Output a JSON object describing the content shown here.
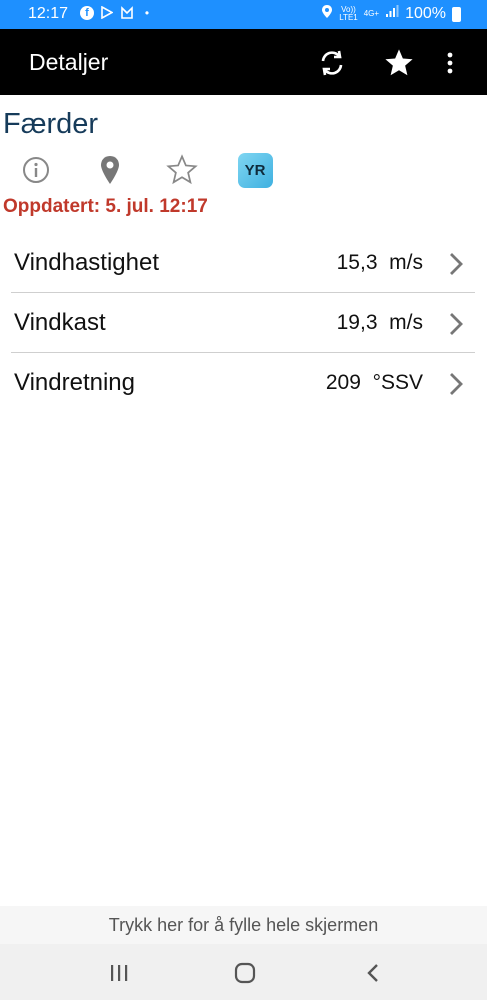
{
  "status_bar": {
    "time": "12:17",
    "network": "4G+",
    "lte": "LTE1",
    "volte": "Vo))",
    "battery": "100%",
    "left_icons": [
      "facebook-icon",
      "play-store-icon",
      "mail-icon",
      "dot-icon"
    ],
    "right_icons": [
      "location-icon",
      "volte-icon",
      "signal-icon",
      "battery-icon"
    ]
  },
  "app_bar": {
    "title": "Detaljer",
    "actions": [
      "refresh-icon",
      "star-icon",
      "more-icon"
    ]
  },
  "station": {
    "name": "Færder",
    "icons": [
      "info-icon",
      "location-pin-icon",
      "favorite-star-icon",
      "yr-logo"
    ],
    "yr_label": "YR",
    "updated": "Oppdatert: 5. jul. 12:17"
  },
  "measurements": [
    {
      "label": "Vindhastighet",
      "value": "15,3  m/s"
    },
    {
      "label": "Vindkast",
      "value": "19,3  m/s"
    },
    {
      "label": "Vindretning",
      "value": "209  °SSV"
    }
  ],
  "fullscreen_hint": "Trykk her for å fylle hele skjermen",
  "colors": {
    "status_bar": "#1e90ff",
    "app_bar": "#000000",
    "station_name": "#163b5a",
    "updated": "#c0392b"
  }
}
